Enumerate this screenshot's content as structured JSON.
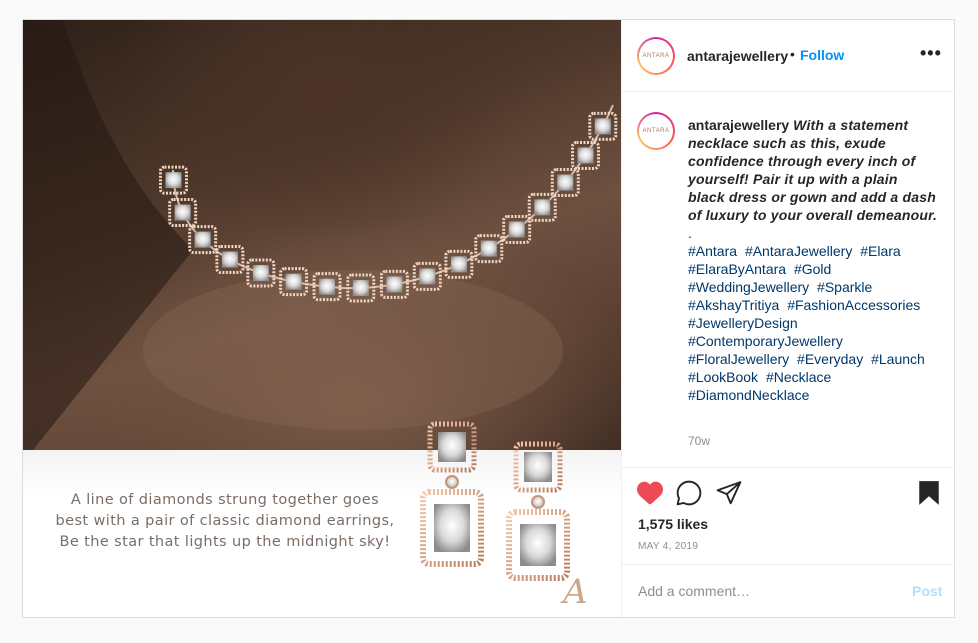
{
  "account": {
    "username": "antarajewellery",
    "follow_label": "Follow",
    "avatar_text": "ANTARA",
    "separator": "•"
  },
  "post": {
    "image_text": [
      "A line of diamonds strung together goes",
      "best with a pair of classic diamond earrings,",
      "Be the star that lights up the midnight sky!"
    ],
    "signature": "A"
  },
  "caption": {
    "username": "antarajewellery",
    "text": "With a statement necklace such as this, exude confidence through every inch of yourself! Pair it up with a plain black dress or gown and add a dash of luxury to your overall demeanour.",
    "dot": ".",
    "hashtags": [
      "#Antara",
      "#AntaraJewellery",
      "#Elara",
      "#ElaraByAntara",
      "#Gold",
      "#WeddingJewellery",
      "#Sparkle",
      "#AkshayTritiya",
      "#FashionAccessories",
      "#JewelleryDesign",
      "#ContemporaryJewellery",
      "#FloralJewellery",
      "#Everyday",
      "#Launch",
      "#LookBook",
      "#Necklace",
      "#DiamondNecklace"
    ],
    "time_ago": "70w"
  },
  "engagement": {
    "likes": "1,575 likes",
    "date": "MAY 4, 2019",
    "liked": true,
    "like_color": "#ed4956"
  },
  "comment_box": {
    "placeholder": "Add a comment…",
    "post_label": "Post"
  },
  "icons": {
    "like": "heart-icon",
    "comment": "comment-bubble-icon",
    "share": "paper-plane-icon",
    "save": "bookmark-icon",
    "more": "more-options-icon"
  }
}
